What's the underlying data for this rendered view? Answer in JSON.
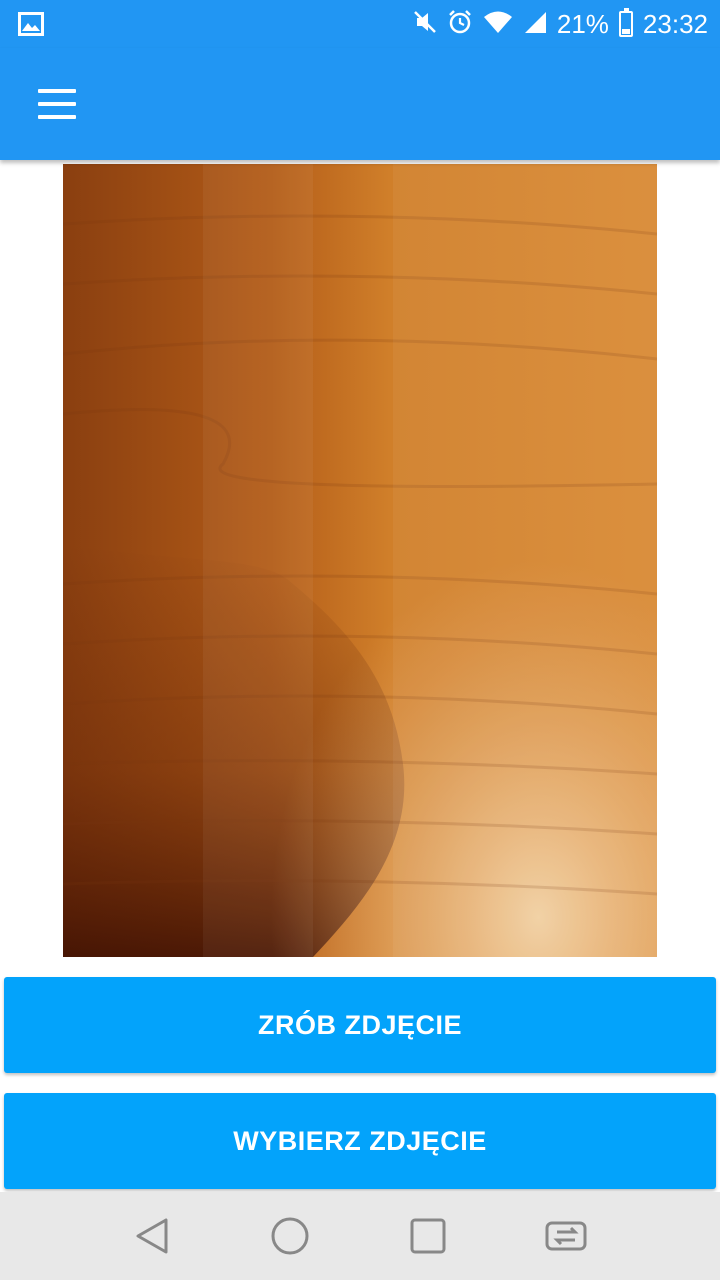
{
  "status_bar": {
    "battery": "21%",
    "time": "23:32",
    "icons": [
      "gallery-icon",
      "mute-icon",
      "alarm-icon",
      "wifi-icon",
      "signal-icon",
      "battery-icon"
    ],
    "battery_level": 0.21
  },
  "app_bar": {
    "menu_icon": "hamburger-menu-icon",
    "color": "#2196f3"
  },
  "photo": {
    "description_icon": "photo"
  },
  "buttons": {
    "take_photo": "ZRÓB ZDJĘCIE",
    "choose_photo": "WYBIERZ ZDJĘCIE",
    "color": "#03a3fb"
  },
  "nav_bar": {
    "icons": [
      "back-icon",
      "home-icon",
      "recents-icon",
      "switch-app-icon"
    ]
  }
}
